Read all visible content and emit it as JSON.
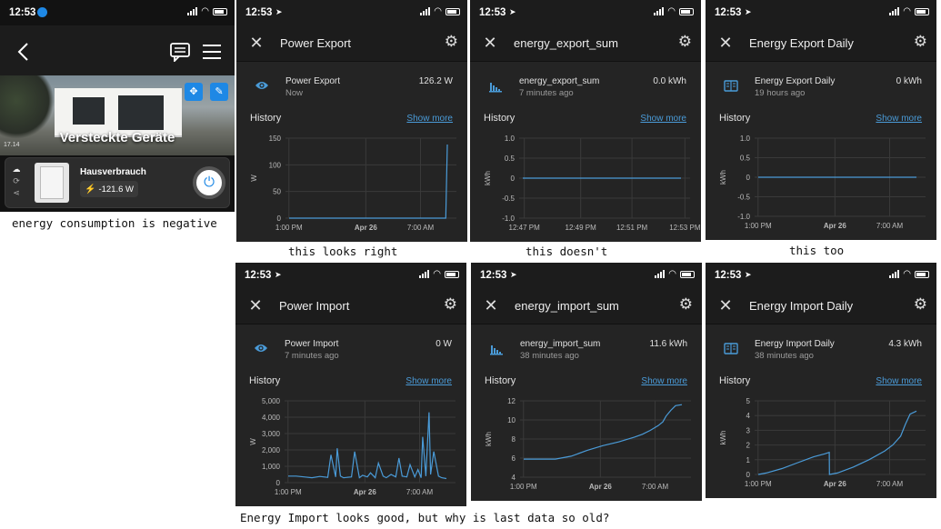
{
  "app": {
    "time": "12:53",
    "hero_title": "Versteckte Geräte",
    "hero_badge": "17.14",
    "device_name": "Hausverbrauch",
    "device_value": "-121.6 W",
    "caption": "energy consumption is negative"
  },
  "panels": [
    {
      "time": "12:53",
      "title": "Power Export",
      "entity": "Power Export",
      "last": "Now",
      "value": "126.2 W",
      "icon": "eye-icon",
      "history": "History",
      "show_more": "Show more",
      "caption": "this looks right",
      "chart_data": {
        "type": "line",
        "ylabel": "W",
        "y_ticks": [
          "150",
          "100",
          "50",
          "0"
        ],
        "x_ticks": [
          "1:00 PM",
          "Apr 26",
          "7:00 AM"
        ],
        "ylim": [
          0,
          150
        ],
        "series": [
          {
            "x": [
              0,
              0.98,
              0.99,
              1.0
            ],
            "y": [
              0,
              0,
              0,
              138
            ]
          }
        ]
      }
    },
    {
      "time": "12:53",
      "title": "energy_export_sum",
      "entity": "energy_export_sum",
      "last": "7 minutes ago",
      "value": "0.0 kWh",
      "icon": "bar-chart-icon",
      "history": "History",
      "show_more": "Show more",
      "caption": "this doesn't",
      "chart_data": {
        "type": "line",
        "ylabel": "kWh",
        "y_ticks": [
          "1.0",
          "0.5",
          "0",
          "-0.5",
          "-1.0"
        ],
        "x_ticks": [
          "12:47 PM",
          "12:49 PM",
          "12:51 PM",
          "12:53 PM"
        ],
        "ylim": [
          -1,
          1
        ],
        "series": [
          {
            "x": [
              0,
              1
            ],
            "y": [
              0,
              0
            ]
          }
        ]
      }
    },
    {
      "time": "12:53",
      "title": "Energy Export Daily",
      "entity": "Energy Export Daily",
      "last": "19 hours ago",
      "value": "0 kWh",
      "icon": "meter-icon",
      "history": "History",
      "show_more": "Show more",
      "caption": "this too",
      "chart_data": {
        "type": "line",
        "ylabel": "kWh",
        "y_ticks": [
          "1.0",
          "0.5",
          "0",
          "-0.5",
          "-1.0"
        ],
        "x_ticks": [
          "1:00 PM",
          "Apr 26",
          "7:00 AM"
        ],
        "ylim": [
          -1,
          1
        ],
        "series": [
          {
            "x": [
              0,
              1
            ],
            "y": [
              0,
              0
            ]
          }
        ]
      }
    },
    {
      "time": "12:53",
      "title": "Power Import",
      "entity": "Power Import",
      "last": "7 minutes ago",
      "value": "0 W",
      "icon": "eye-icon",
      "history": "History",
      "show_more": "Show more",
      "caption": "",
      "chart_data": {
        "type": "line",
        "ylabel": "W",
        "y_ticks": [
          "5,000",
          "4,000",
          "3,000",
          "2,000",
          "1,000",
          "0"
        ],
        "x_ticks": [
          "1:00 PM",
          "Apr 26",
          "7:00 AM"
        ],
        "ylim": [
          0,
          5000
        ],
        "series": [
          {
            "x": [
              0,
              0.05,
              0.1,
              0.15,
              0.2,
              0.25,
              0.27,
              0.3,
              0.31,
              0.33,
              0.35,
              0.4,
              0.42,
              0.45,
              0.47,
              0.5,
              0.52,
              0.55,
              0.57,
              0.6,
              0.62,
              0.65,
              0.68,
              0.7,
              0.72,
              0.75,
              0.77,
              0.8,
              0.82,
              0.84,
              0.85,
              0.87,
              0.89,
              0.9,
              0.92,
              0.95,
              0.97,
              1.0
            ],
            "y": [
              400,
              400,
              350,
              300,
              380,
              320,
              1700,
              350,
              2100,
              400,
              300,
              350,
              1900,
              300,
              450,
              350,
              600,
              300,
              1200,
              400,
              300,
              500,
              350,
              1500,
              400,
              350,
              1100,
              350,
              800,
              300,
              2800,
              400,
              4300,
              500,
              1900,
              400,
              300,
              250
            ]
          }
        ]
      }
    },
    {
      "time": "12:53",
      "title": "energy_import_sum",
      "entity": "energy_import_sum",
      "last": "38 minutes ago",
      "value": "11.6 kWh",
      "icon": "bar-chart-icon",
      "history": "History",
      "show_more": "Show more",
      "caption": "",
      "chart_data": {
        "type": "line",
        "ylabel": "kWh",
        "y_ticks": [
          "12",
          "10",
          "8",
          "6",
          "4"
        ],
        "x_ticks": [
          "1:00 PM",
          "Apr 26",
          "7:00 AM"
        ],
        "ylim": [
          4,
          12
        ],
        "series": [
          {
            "x": [
              0,
              0.2,
              0.3,
              0.4,
              0.5,
              0.6,
              0.7,
              0.75,
              0.8,
              0.85,
              0.88,
              0.9,
              0.93,
              0.96,
              1.0
            ],
            "y": [
              5.9,
              5.9,
              6.2,
              6.8,
              7.3,
              7.7,
              8.2,
              8.5,
              8.9,
              9.4,
              9.8,
              10.4,
              11.0,
              11.5,
              11.6
            ]
          }
        ]
      }
    },
    {
      "time": "12:53",
      "title": "Energy Import Daily",
      "entity": "Energy Import Daily",
      "last": "38 minutes ago",
      "value": "4.3 kWh",
      "icon": "meter-icon",
      "history": "History",
      "show_more": "Show more",
      "caption": "",
      "chart_data": {
        "type": "line",
        "ylabel": "kWh",
        "y_ticks": [
          "5",
          "4",
          "3",
          "2",
          "1",
          "0"
        ],
        "x_ticks": [
          "1:00 PM",
          "Apr 26",
          "7:00 AM"
        ],
        "ylim": [
          0,
          5
        ],
        "series": [
          {
            "x": [
              0,
              0.05,
              0.15,
              0.25,
              0.35,
              0.42,
              0.449,
              0.45,
              0.5,
              0.6,
              0.7,
              0.8,
              0.85,
              0.9,
              0.93,
              0.96,
              1.0
            ],
            "y": [
              0,
              0.1,
              0.4,
              0.8,
              1.2,
              1.4,
              1.5,
              0,
              0.1,
              0.5,
              1.0,
              1.6,
              2.0,
              2.6,
              3.4,
              4.1,
              4.3
            ]
          }
        ]
      }
    }
  ],
  "bottom_caption": "Energy Import looks good, but why is last data so old?"
}
